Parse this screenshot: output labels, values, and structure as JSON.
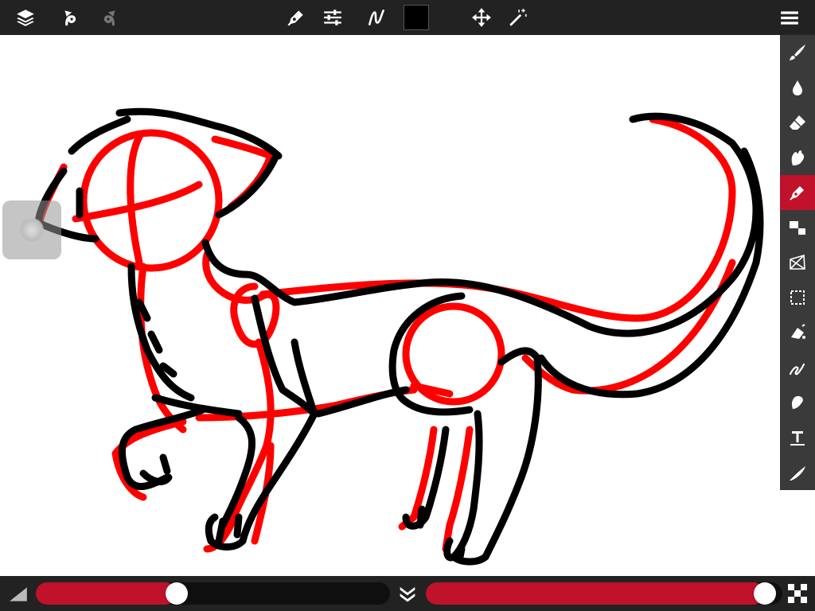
{
  "colors": {
    "accent": "#c0122b",
    "bar_bg": "#222222",
    "toolbar_bg": "#3a3a3a",
    "current_color": "#000000",
    "sketch_red": "#ff0000",
    "sketch_black": "#000000"
  },
  "top_bar": {
    "left_icons": [
      "layers-icon",
      "undo-icon",
      "redo-icon"
    ],
    "center_icons": [
      "pen-settings-icon",
      "sliders-icon",
      "stroke-icon",
      "color-swatch",
      "move-icon",
      "magic-wand-icon"
    ],
    "right_icons": [
      "menu-icon"
    ]
  },
  "tools": [
    {
      "name": "brush-icon",
      "active": false
    },
    {
      "name": "ink-drop-icon",
      "active": false
    },
    {
      "name": "eraser-icon",
      "active": false
    },
    {
      "name": "smudge-icon",
      "active": false
    },
    {
      "name": "pen-icon",
      "active": true
    },
    {
      "name": "layer-transform-icon",
      "active": false
    },
    {
      "name": "warp-icon",
      "active": false
    },
    {
      "name": "selection-icon",
      "active": false
    },
    {
      "name": "fill-icon",
      "active": false
    },
    {
      "name": "scribble-icon",
      "active": false
    },
    {
      "name": "paint-bucket-icon",
      "active": false
    },
    {
      "name": "text-icon",
      "active": false
    },
    {
      "name": "calligraphy-icon",
      "active": false
    }
  ],
  "bottom_bar": {
    "size_slider_value": 0.39,
    "opacity_slider_value": 0.98,
    "icons": [
      "size-triangle-icon",
      "collapse-icon",
      "opacity-checker-icon"
    ]
  }
}
